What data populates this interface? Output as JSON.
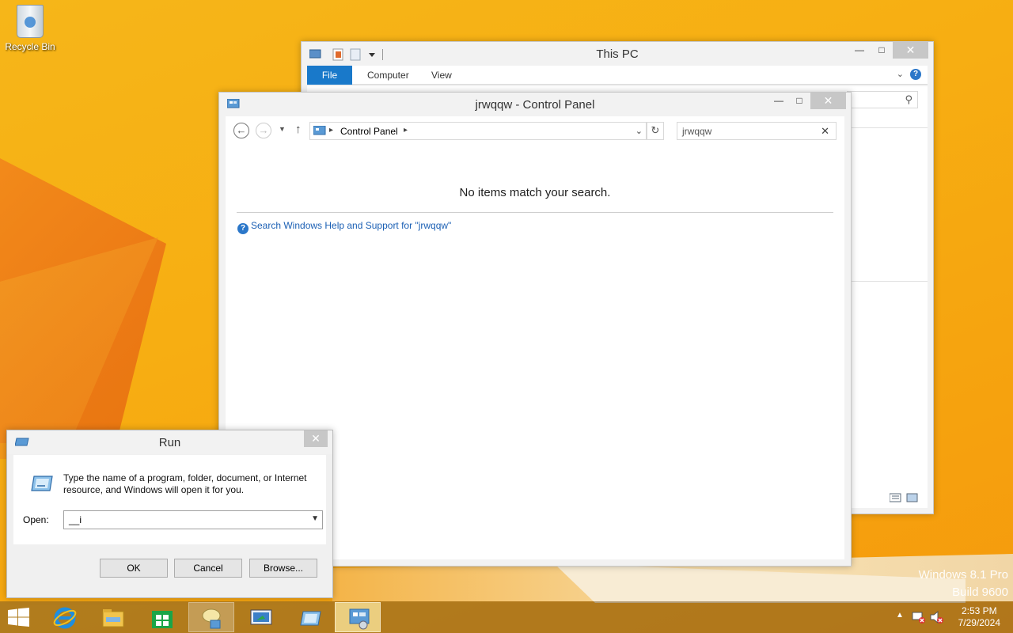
{
  "desktop": {
    "recycle_bin_label": "Recycle Bin",
    "watermark_line1": "Windows 8.1 Pro",
    "watermark_line2": "Build 9600"
  },
  "this_pc": {
    "title": "This PC",
    "tabs": [
      "File",
      "Computer",
      "View"
    ]
  },
  "control_panel": {
    "title": "jrwqqw - Control Panel",
    "breadcrumb": "Control Panel",
    "search_value": "jrwqqw",
    "no_items": "No items match your search.",
    "help_link": "Search Windows Help and Support for \"jrwqqw\""
  },
  "run": {
    "title": "Run",
    "message": "Type the name of a program, folder, document, or Internet resource, and Windows will open it for you.",
    "open_label": "Open:",
    "open_value": "__i",
    "ok": "OK",
    "cancel": "Cancel",
    "browse": "Browse..."
  },
  "taskbar": {
    "time": "2:53 PM",
    "date": "7/29/2024"
  },
  "colors": {
    "accent_blue": "#1979ca",
    "link_blue": "#1a5fb4",
    "desktop_orange": "#f7ae12"
  }
}
